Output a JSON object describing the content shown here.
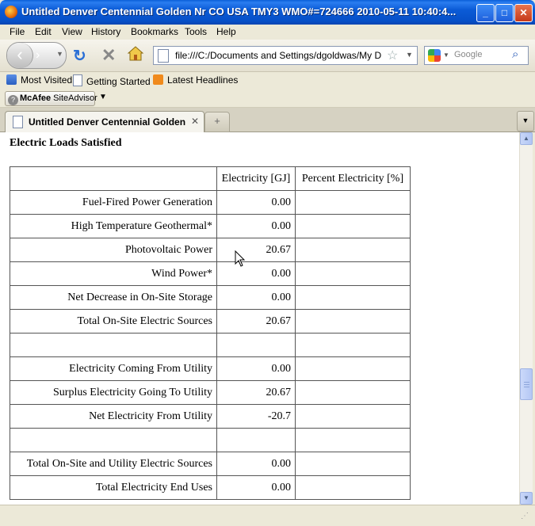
{
  "window": {
    "title": "Untitled Denver Centennial Golden Nr CO USA TMY3 WMO#=724666 2010-05-11 10:40:4...",
    "minimize_label": "_",
    "maximize_label": "□",
    "close_label": "✕"
  },
  "menu": {
    "file": "File",
    "edit": "Edit",
    "view": "View",
    "history": "History",
    "bookmarks": "Bookmarks",
    "tools": "Tools",
    "help": "Help"
  },
  "nav": {
    "url": "file:///C:/Documents and Settings/dgoldwas/My Docum",
    "search_placeholder": "Google"
  },
  "bookmarks_bar": {
    "most_visited": "Most Visited",
    "getting_started": "Getting Started",
    "latest_headlines": "Latest Headlines"
  },
  "mcafee": {
    "label_bold": "McAfee",
    "label_rest": " SiteAdvisor"
  },
  "tabs": {
    "active_label": "Untitled Denver Centennial Golden N..."
  },
  "content": {
    "heading": "Electric Loads Satisfied",
    "table": {
      "headers": [
        "",
        "Electricity [GJ]",
        "Percent Electricity [%]"
      ],
      "rows": [
        [
          "Fuel-Fired Power Generation",
          "0.00",
          ""
        ],
        [
          "High Temperature Geothermal*",
          "0.00",
          ""
        ],
        [
          "Photovoltaic Power",
          "20.67",
          ""
        ],
        [
          "Wind Power*",
          "0.00",
          ""
        ],
        [
          "Net Decrease in On-Site Storage",
          "0.00",
          ""
        ],
        [
          "Total On-Site Electric Sources",
          "20.67",
          ""
        ],
        [
          "",
          "",
          ""
        ],
        [
          "Electricity Coming From Utility",
          "0.00",
          ""
        ],
        [
          "Surplus Electricity Going To Utility",
          "20.67",
          ""
        ],
        [
          "Net Electricity From Utility",
          "-20.7",
          ""
        ],
        [
          "",
          "",
          ""
        ],
        [
          "Total On-Site and Utility Electric Sources",
          "0.00",
          ""
        ],
        [
          "Total Electricity End Uses",
          "0.00",
          ""
        ]
      ]
    }
  }
}
